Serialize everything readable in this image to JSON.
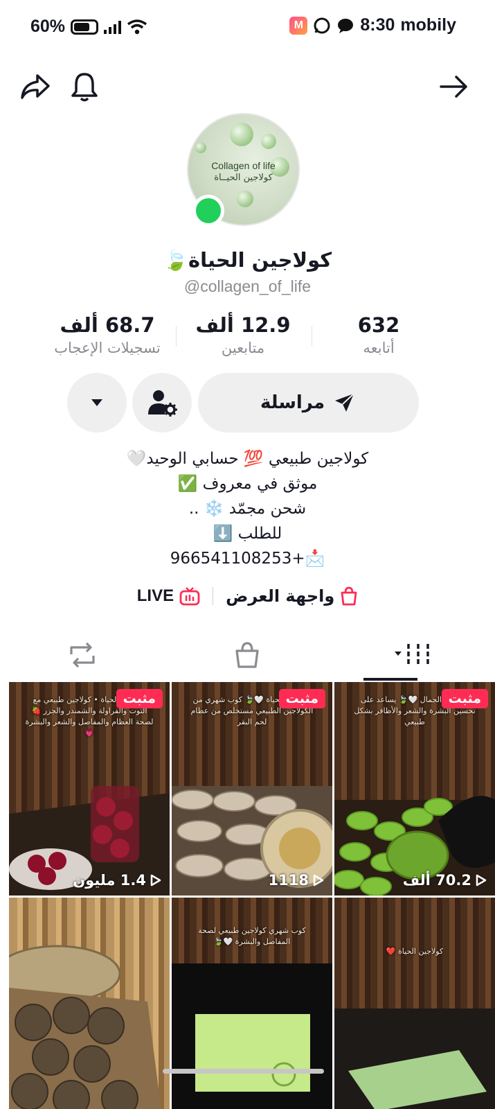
{
  "status_bar": {
    "battery": "60%",
    "time": "8:30",
    "carrier": "mobily"
  },
  "header": {
    "share_icon": "share-icon",
    "bell_icon": "bell-icon",
    "back_icon": "arrow-right-icon"
  },
  "profile": {
    "avatar_text_en": "Collagen of life",
    "avatar_text_ar": "كولاجين الحيــاة",
    "name": "كولاجين الحياة🍃",
    "handle": "@collagen_of_life"
  },
  "stats": [
    {
      "value": "632",
      "label": "أتابعه"
    },
    {
      "value": "12.9 ألف",
      "label": "متابعين"
    },
    {
      "value": "68.7 ألف",
      "label": "تسجيلات الإعجاب"
    }
  ],
  "actions": {
    "message_label": "مراسلة"
  },
  "bio": [
    "كولاجين طبيعي 💯 حسابي الوحيد🤍",
    "موثق في معروف ✅",
    "شحن مجمّد ❄️ ..",
    "للطلب ⬇️",
    "📩+966541108253"
  ],
  "links": {
    "showcase": "واجهة العرض",
    "live": "LIVE"
  },
  "grid": {
    "pinned_label": "مثبت",
    "tiles": [
      {
        "caption": "كولاجين الجمال 🤍🍃 يساعد على تحسين البشرة والشعر والأظافر بشكل طبيعي",
        "views": "70.2 ألف",
        "pinned": true
      },
      {
        "caption": "كولاجين الحياة 🤍🍃 كوب شهري من الكولاجين الطبيعي مستخلص من عظام لحم البقر",
        "views": "1118",
        "pinned": true
      },
      {
        "caption": "كولاجين الحياة • كولاجين طبيعي مع التوت والفراولة والشمندر والجزر 🍓 لصحة العظام والمفاصل والشعر والبشرة 💗",
        "views": "1.4 مليون",
        "pinned": true
      },
      {
        "caption": "كولاجين الحياة ❤️",
        "views": "",
        "pinned": false
      },
      {
        "caption": "كوب شهري كولاجين طبيعي لصحة المفاصل والبشرة 🤍🍃",
        "views": "",
        "pinned": false
      },
      {
        "caption": "",
        "views": "",
        "pinned": false
      }
    ]
  }
}
